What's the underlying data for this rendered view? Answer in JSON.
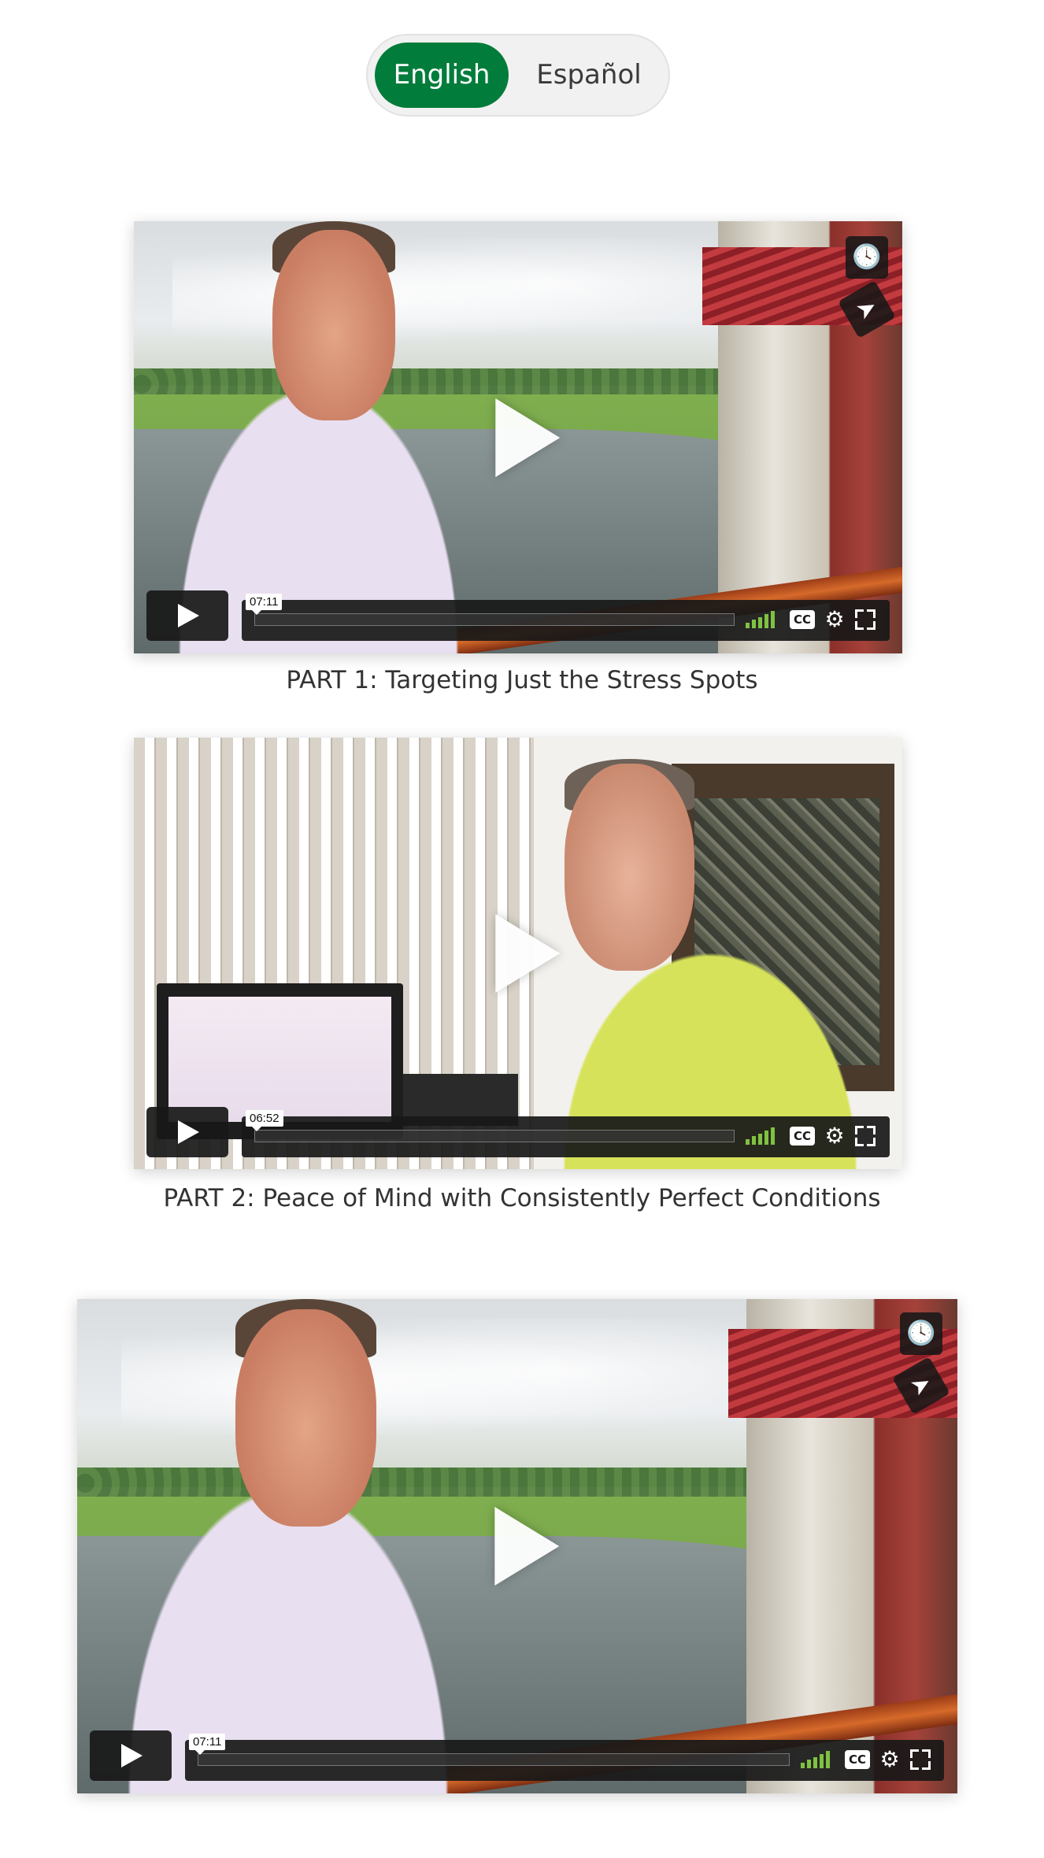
{
  "language_toggle": {
    "options": [
      "English",
      "Español"
    ],
    "selected": "English",
    "active_color": "#027c3b"
  },
  "videos": [
    {
      "duration": "07:11",
      "caption": "PART 1: Targeting Just the Stress Spots",
      "icons": [
        "play-icon",
        "clock-icon",
        "send-icon",
        "volume-icon",
        "cc-icon",
        "gear-icon",
        "fullscreen-icon"
      ]
    },
    {
      "duration": "06:52",
      "caption": "PART 2: Peace of Mind with Consistently Perfect Conditions",
      "icons": [
        "play-icon",
        "volume-icon",
        "cc-icon",
        "gear-icon",
        "fullscreen-icon"
      ]
    },
    {
      "duration": "07:11",
      "caption": "",
      "icons": [
        "play-icon",
        "clock-icon",
        "send-icon",
        "volume-icon",
        "cc-icon",
        "gear-icon",
        "fullscreen-icon"
      ]
    }
  ],
  "icons_text": {
    "clock": "🕓",
    "send": "➤",
    "gear": "⚙",
    "cc": "CC"
  },
  "colors": {
    "volume_bars": "#7fc241",
    "controls_bg": "#181818"
  }
}
